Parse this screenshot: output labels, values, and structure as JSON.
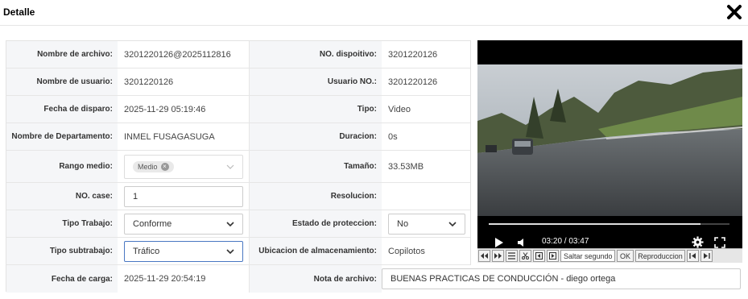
{
  "header": {
    "title": "Detalle"
  },
  "icons": {
    "close": "close-icon"
  },
  "fields": {
    "archivo_label": "Nombre de archivo:",
    "archivo_value": "3201220126@2025112816",
    "dispositivo_label": "NO. dispoitivo:",
    "dispositivo_value": "3201220126",
    "usuario_label": "Nombre de usuario:",
    "usuario_value": "3201220126",
    "usuario_no_label": "Usuario NO.:",
    "usuario_no_value": "3201220126",
    "disparo_label": "Fecha de disparo:",
    "disparo_value": "2025-11-29 05:19:46",
    "tipo_label": "Tipo:",
    "tipo_value": "Video",
    "departamento_label": "Nombre de Departamento:",
    "departamento_value": "INMEL FUSAGASUGA",
    "duracion_label": "Duracion:",
    "duracion_value": "0s",
    "rango_label": "Rango medio:",
    "rango_tag": "Medio",
    "tamano_label": "Tamaño:",
    "tamano_value": "33.53MB",
    "case_label": "NO. case:",
    "case_value": "1",
    "resolucion_label": "Resolucion:",
    "trabajo_label": "Tipo Trabajo:",
    "trabajo_value": "Conforme",
    "proteccion_label": "Estado de proteccion:",
    "proteccion_value": "No",
    "subtrabajo_label": "Tipo subtrabajo:",
    "subtrabajo_value": "Tráfico",
    "almacenamiento_label": "Ubicacion de almacenamiento:",
    "almacenamiento_value": "Copilotos",
    "carga_label": "Fecha de carga:",
    "carga_value": "2025-11-29 20:54:19",
    "nota_label": "Nota de archivo:",
    "nota_value": "BUENAS PRACTICAS DE CONDUCCIÓN - diego ortega"
  },
  "player": {
    "time": "03:20 / 03:47",
    "progress_fraction": 0.88
  },
  "toolbar": {
    "saltar_placeholder": "Saltar segundo",
    "ok_label": "OK",
    "repro_label": "Reproduccion"
  }
}
